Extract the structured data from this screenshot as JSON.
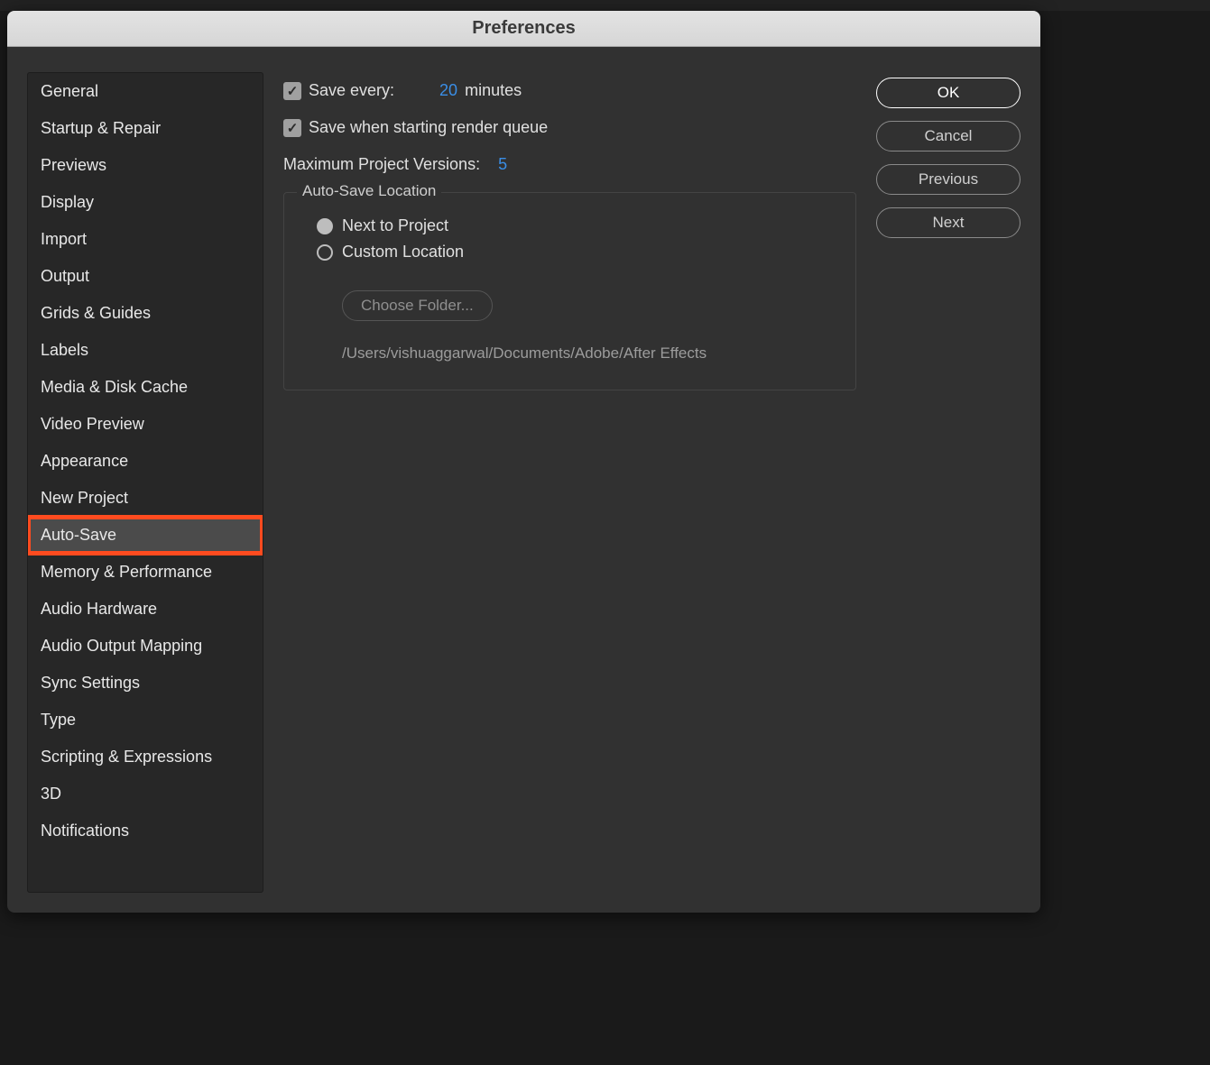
{
  "window": {
    "title": "Preferences"
  },
  "sidebar": {
    "items": [
      {
        "label": "General"
      },
      {
        "label": "Startup & Repair"
      },
      {
        "label": "Previews"
      },
      {
        "label": "Display"
      },
      {
        "label": "Import"
      },
      {
        "label": "Output"
      },
      {
        "label": "Grids & Guides"
      },
      {
        "label": "Labels"
      },
      {
        "label": "Media & Disk Cache"
      },
      {
        "label": "Video Preview"
      },
      {
        "label": "Appearance"
      },
      {
        "label": "New Project"
      },
      {
        "label": "Auto-Save"
      },
      {
        "label": "Memory & Performance"
      },
      {
        "label": "Audio Hardware"
      },
      {
        "label": "Audio Output Mapping"
      },
      {
        "label": "Sync Settings"
      },
      {
        "label": "Type"
      },
      {
        "label": "Scripting & Expressions"
      },
      {
        "label": "3D"
      },
      {
        "label": "Notifications"
      }
    ],
    "selected_index": 12
  },
  "settings": {
    "save_every_label": "Save every:",
    "save_every_value": "20",
    "save_every_unit": "minutes",
    "save_on_render_label": "Save when starting render queue",
    "max_versions_label": "Maximum Project Versions:",
    "max_versions_value": "5",
    "location": {
      "legend": "Auto-Save Location",
      "opt_next_to_project": "Next to Project",
      "opt_custom": "Custom Location",
      "choose_label": "Choose Folder...",
      "path": "/Users/vishuaggarwal/Documents/Adobe/After Effects"
    }
  },
  "buttons": {
    "ok": "OK",
    "cancel": "Cancel",
    "previous": "Previous",
    "next": "Next"
  },
  "highlight": {
    "sidebar_item_index": 12
  }
}
